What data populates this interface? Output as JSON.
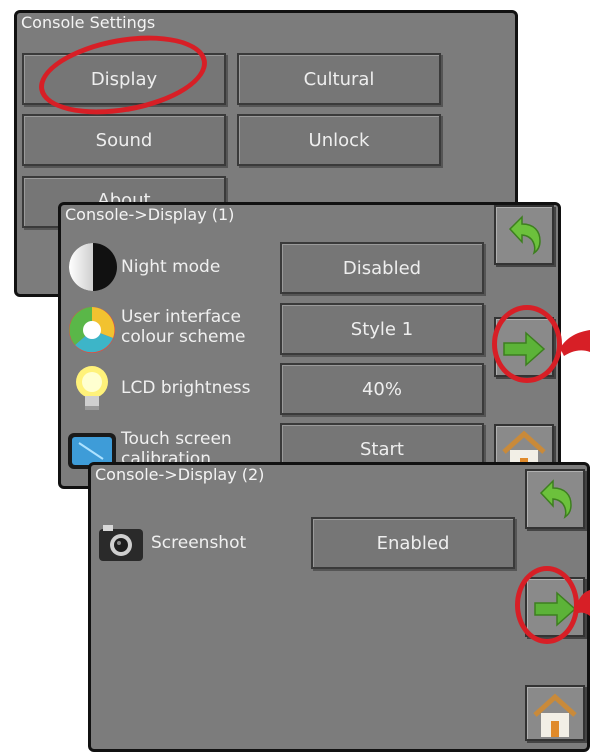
{
  "panel1": {
    "title": "Console Settings",
    "buttons": {
      "display": "Display",
      "cultural": "Cultural",
      "sound": "Sound",
      "unlock": "Unlock",
      "about": "About"
    }
  },
  "panel2": {
    "title": "Console->Display (1)",
    "rows": [
      {
        "label": "Night mode",
        "value": "Disabled"
      },
      {
        "label": "User interface\ncolour scheme",
        "value": "Style 1"
      },
      {
        "label": "LCD brightness",
        "value": "40%"
      },
      {
        "label": "Touch screen\ncalibration",
        "value": "Start"
      }
    ]
  },
  "panel3": {
    "title": "Console->Display (2)",
    "rows": [
      {
        "label": "Screenshot",
        "value": "Enabled"
      }
    ]
  },
  "colors": {
    "panel": "#7c7c7c",
    "highlight_ring": "#d71f26",
    "arrow_green": "#5cb338"
  },
  "icons": [
    "night-mode-icon",
    "colour-scheme-icon",
    "lcd-brightness-icon",
    "touch-screen-icon",
    "screenshot-icon",
    "back-arrow-icon",
    "next-arrow-icon",
    "home-icon"
  ]
}
